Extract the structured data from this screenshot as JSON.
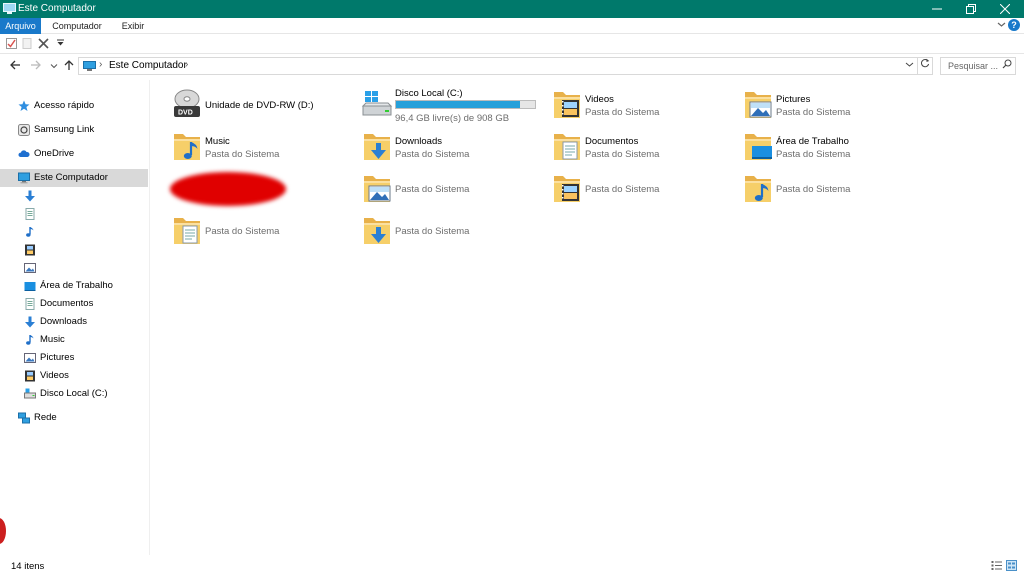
{
  "window": {
    "title": "Este Computador"
  },
  "ribbon": {
    "tabs": [
      "Arquivo",
      "Computador",
      "Exibir"
    ],
    "expand_icon": "chevron-down-icon",
    "help_label": "?"
  },
  "address": {
    "crumb": "Este Computador",
    "search_placeholder": "Pesquisar ..."
  },
  "sidebar": {
    "items": [
      {
        "label": "Acesso rápido",
        "icon": "star-icon"
      },
      {
        "label": "Samsung Link",
        "icon": "samsung-link-icon"
      },
      {
        "label": "OneDrive",
        "icon": "cloud-icon"
      },
      {
        "label": "Este Computador",
        "icon": "monitor-icon",
        "selected": true
      },
      {
        "label": "",
        "icon": "download-arrow-icon"
      },
      {
        "label": "",
        "icon": "document-icon"
      },
      {
        "label": "",
        "icon": "music-note-icon"
      },
      {
        "label": "",
        "icon": "film-icon"
      },
      {
        "label": "",
        "icon": "picture-icon"
      },
      {
        "label": "Área de Trabalho",
        "icon": "desktop-icon"
      },
      {
        "label": "Documentos",
        "icon": "document-icon"
      },
      {
        "label": "Downloads",
        "icon": "download-arrow-icon"
      },
      {
        "label": "Music",
        "icon": "music-note-icon"
      },
      {
        "label": "Pictures",
        "icon": "picture-icon"
      },
      {
        "label": "Videos",
        "icon": "film-icon"
      },
      {
        "label": "Disco Local (C:)",
        "icon": "drive-icon"
      },
      {
        "label": "Rede",
        "icon": "network-icon"
      }
    ]
  },
  "content": {
    "items": [
      {
        "name": "Unidade de DVD-RW (D:)",
        "sub": "",
        "icon": "dvd-drive-icon"
      },
      {
        "name": "Disco Local (C:)",
        "sub": "96,4 GB livre(s) de 908 GB",
        "icon": "windows-drive-icon",
        "used_fraction": 0.894
      },
      {
        "name": "Videos",
        "sub": "Pasta do Sistema",
        "icon": "videos-folder-icon"
      },
      {
        "name": "Pictures",
        "sub": "Pasta do Sistema",
        "icon": "pictures-folder-icon"
      },
      {
        "name": "Music",
        "sub": "Pasta do Sistema",
        "icon": "music-folder-icon"
      },
      {
        "name": "Downloads",
        "sub": "Pasta do Sistema",
        "icon": "downloads-folder-icon"
      },
      {
        "name": "Documentos",
        "sub": "Pasta do Sistema",
        "icon": "documents-folder-icon"
      },
      {
        "name": "Área de Trabalho",
        "sub": "Pasta do Sistema",
        "icon": "desktop-folder-icon"
      },
      {
        "name": "",
        "sub": "",
        "icon": "redacted"
      },
      {
        "name": "",
        "sub": "Pasta do Sistema",
        "icon": "pictures-folder-icon"
      },
      {
        "name": "",
        "sub": "Pasta do Sistema",
        "icon": "videos-folder-icon"
      },
      {
        "name": "",
        "sub": "Pasta do Sistema",
        "icon": "music-folder-icon"
      },
      {
        "name": "",
        "sub": "Pasta do Sistema",
        "icon": "documents-folder-icon"
      },
      {
        "name": "",
        "sub": "Pasta do Sistema",
        "icon": "downloads-folder-icon"
      }
    ]
  },
  "status": {
    "count": "14 itens"
  },
  "colors": {
    "titlebar": "#00796b",
    "accent": "#1979ca",
    "drive_fill": "#26a0da",
    "folder": "#f4c75b"
  }
}
